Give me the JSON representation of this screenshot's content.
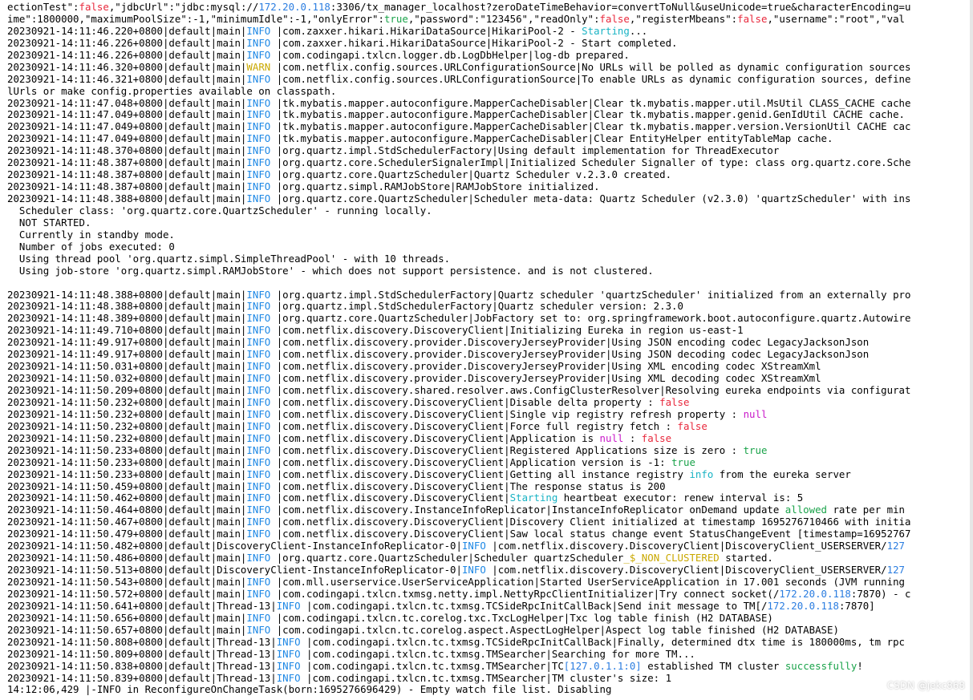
{
  "colors": {
    "false": "#e8283c",
    "null": "#c918c9",
    "true": "#1aa34a",
    "warn": "#c9a800",
    "info": "#1e88e5",
    "ip": "#2b7de0",
    "keyword": "#18b3c4"
  },
  "lines": [
    [
      [
        "ectionTest\":",
        ""
      ],
      [
        "false",
        "false"
      ],
      [
        ",\"jdbcUrl\":\"jdbc:mysql://",
        ""
      ],
      [
        "172.20.0.118",
        "ip"
      ],
      [
        ":3306/tx_manager_localhost?zeroDateTimeBehavior=convertToNull&useUnicode=true&characterEncoding=u",
        ""
      ]
    ],
    [
      [
        "ime\":1800000,\"maximumPoolSize\":-1,\"minimumIdle\":-1,\"onlyError\":",
        ""
      ],
      [
        "true",
        "true"
      ],
      [
        ",\"password\":\"123456\",\"readOnly\":",
        ""
      ],
      [
        "false",
        "false"
      ],
      [
        ",\"registerMbeans\":",
        ""
      ],
      [
        "false",
        "false"
      ],
      [
        ",\"username\":\"root\",\"val",
        ""
      ]
    ],
    [
      [
        "20230921-14:11:46.220+0800|default|main|",
        ""
      ],
      [
        "INFO",
        "info"
      ],
      [
        " |com.zaxxer.hikari.HikariDataSource|HikariPool-2 - ",
        ""
      ],
      [
        "Starting",
        "kw"
      ],
      [
        "...",
        ""
      ]
    ],
    [
      [
        "20230921-14:11:46.226+0800|default|main|",
        ""
      ],
      [
        "INFO",
        "info"
      ],
      [
        " |com.zaxxer.hikari.HikariDataSource|HikariPool-2 - Start completed.",
        ""
      ]
    ],
    [
      [
        "20230921-14:11:46.226+0800|default|main|",
        ""
      ],
      [
        "INFO",
        "info"
      ],
      [
        " |com.codingapi.txlcn.logger.db.LogDbHelper|log-db prepared.",
        ""
      ]
    ],
    [
      [
        "20230921-14:11:46.320+0800|default|main|",
        ""
      ],
      [
        "WARN",
        "warn"
      ],
      [
        " |com.netflix.config.sources.URLConfigurationSource|No URLs will be polled as dynamic configuration sources",
        ""
      ]
    ],
    [
      [
        "20230921-14:11:46.321+0800|default|main|",
        ""
      ],
      [
        "INFO",
        "info"
      ],
      [
        " |com.netflix.config.sources.URLConfigurationSource|To enable URLs as dynamic configuration sources, define",
        ""
      ]
    ],
    [
      [
        "lUrls or make config.properties available on classpath.",
        ""
      ]
    ],
    [
      [
        "20230921-14:11:47.048+0800|default|main|",
        ""
      ],
      [
        "INFO",
        "info"
      ],
      [
        " |tk.mybatis.mapper.autoconfigure.MapperCacheDisabler|Clear tk.mybatis.mapper.util.MsUtil CLASS_CACHE cache",
        ""
      ]
    ],
    [
      [
        "20230921-14:11:47.049+0800|default|main|",
        ""
      ],
      [
        "INFO",
        "info"
      ],
      [
        " |tk.mybatis.mapper.autoconfigure.MapperCacheDisabler|Clear tk.mybatis.mapper.genid.GenIdUtil CACHE cache.",
        ""
      ]
    ],
    [
      [
        "20230921-14:11:47.049+0800|default|main|",
        ""
      ],
      [
        "INFO",
        "info"
      ],
      [
        " |tk.mybatis.mapper.autoconfigure.MapperCacheDisabler|Clear tk.mybatis.mapper.version.VersionUtil CACHE cac",
        ""
      ]
    ],
    [
      [
        "20230921-14:11:47.049+0800|default|main|",
        ""
      ],
      [
        "INFO",
        "info"
      ],
      [
        " |tk.mybatis.mapper.autoconfigure.MapperCacheDisabler|Clear EntityHelper entityTableMap cache.",
        ""
      ]
    ],
    [
      [
        "20230921-14:11:48.370+0800|default|main|",
        ""
      ],
      [
        "INFO",
        "info"
      ],
      [
        " |org.quartz.impl.StdSchedulerFactory|Using default implementation for ThreadExecutor",
        ""
      ]
    ],
    [
      [
        "20230921-14:11:48.387+0800|default|main|",
        ""
      ],
      [
        "INFO",
        "info"
      ],
      [
        " |org.quartz.core.SchedulerSignalerImpl|Initialized Scheduler Signaller of type: class org.quartz.core.Sche",
        ""
      ]
    ],
    [
      [
        "20230921-14:11:48.387+0800|default|main|",
        ""
      ],
      [
        "INFO",
        "info"
      ],
      [
        " |org.quartz.core.QuartzScheduler|Quartz Scheduler v.2.3.0 created.",
        ""
      ]
    ],
    [
      [
        "20230921-14:11:48.387+0800|default|main|",
        ""
      ],
      [
        "INFO",
        "info"
      ],
      [
        " |org.quartz.simpl.RAMJobStore|RAMJobStore initialized.",
        ""
      ]
    ],
    [
      [
        "20230921-14:11:48.388+0800|default|main|",
        ""
      ],
      [
        "INFO",
        "info"
      ],
      [
        " |org.quartz.core.QuartzScheduler|Scheduler meta-data: Quartz Scheduler (v2.3.0) 'quartzScheduler' with ins",
        ""
      ]
    ],
    [
      [
        "  Scheduler class: 'org.quartz.core.QuartzScheduler' - running locally.",
        ""
      ]
    ],
    [
      [
        "  NOT STARTED.",
        ""
      ]
    ],
    [
      [
        "  Currently in standby mode.",
        ""
      ]
    ],
    [
      [
        "  Number of jobs executed: 0",
        ""
      ]
    ],
    [
      [
        "  Using thread pool 'org.quartz.simpl.SimpleThreadPool' - with 10 threads.",
        ""
      ]
    ],
    [
      [
        "  Using job-store 'org.quartz.simpl.RAMJobStore' - which does not support persistence. and is not clustered.",
        ""
      ]
    ],
    [],
    [
      [
        "20230921-14:11:48.388+0800|default|main|",
        ""
      ],
      [
        "INFO",
        "info"
      ],
      [
        " |org.quartz.impl.StdSchedulerFactory|Quartz scheduler 'quartzScheduler' initialized from an externally pro",
        ""
      ]
    ],
    [
      [
        "20230921-14:11:48.388+0800|default|main|",
        ""
      ],
      [
        "INFO",
        "info"
      ],
      [
        " |org.quartz.impl.StdSchedulerFactory|Quartz scheduler version: 2.3.0",
        ""
      ]
    ],
    [
      [
        "20230921-14:11:48.389+0800|default|main|",
        ""
      ],
      [
        "INFO",
        "info"
      ],
      [
        " |org.quartz.core.QuartzScheduler|JobFactory set to: org.springframework.boot.autoconfigure.quartz.Autowire",
        ""
      ]
    ],
    [
      [
        "20230921-14:11:49.710+0800|default|main|",
        ""
      ],
      [
        "INFO",
        "info"
      ],
      [
        " |com.netflix.discovery.DiscoveryClient|Initializing Eureka in region us-east-1",
        ""
      ]
    ],
    [
      [
        "20230921-14:11:49.917+0800|default|main|",
        ""
      ],
      [
        "INFO",
        "info"
      ],
      [
        " |com.netflix.discovery.provider.DiscoveryJerseyProvider|Using JSON encoding codec LegacyJacksonJson",
        ""
      ]
    ],
    [
      [
        "20230921-14:11:49.917+0800|default|main|",
        ""
      ],
      [
        "INFO",
        "info"
      ],
      [
        " |com.netflix.discovery.provider.DiscoveryJerseyProvider|Using JSON decoding codec LegacyJacksonJson",
        ""
      ]
    ],
    [
      [
        "20230921-14:11:50.031+0800|default|main|",
        ""
      ],
      [
        "INFO",
        "info"
      ],
      [
        " |com.netflix.discovery.provider.DiscoveryJerseyProvider|Using XML encoding codec XStreamXml",
        ""
      ]
    ],
    [
      [
        "20230921-14:11:50.032+0800|default|main|",
        ""
      ],
      [
        "INFO",
        "info"
      ],
      [
        " |com.netflix.discovery.provider.DiscoveryJerseyProvider|Using XML decoding codec XStreamXml",
        ""
      ]
    ],
    [
      [
        "20230921-14:11:50.209+0800|default|main|",
        ""
      ],
      [
        "INFO",
        "info"
      ],
      [
        " |com.netflix.discovery.shared.resolver.aws.ConfigClusterResolver|Resolving eureka endpoints via configurat",
        ""
      ]
    ],
    [
      [
        "20230921-14:11:50.232+0800|default|main|",
        ""
      ],
      [
        "INFO",
        "info"
      ],
      [
        " |com.netflix.discovery.DiscoveryClient|Disable delta property : ",
        ""
      ],
      [
        "false",
        "false"
      ]
    ],
    [
      [
        "20230921-14:11:50.232+0800|default|main|",
        ""
      ],
      [
        "INFO",
        "info"
      ],
      [
        " |com.netflix.discovery.DiscoveryClient|Single vip registry refresh property : ",
        ""
      ],
      [
        "null",
        "null"
      ]
    ],
    [
      [
        "20230921-14:11:50.232+0800|default|main|",
        ""
      ],
      [
        "INFO",
        "info"
      ],
      [
        " |com.netflix.discovery.DiscoveryClient|Force full registry fetch : ",
        ""
      ],
      [
        "false",
        "false"
      ]
    ],
    [
      [
        "20230921-14:11:50.232+0800|default|main|",
        ""
      ],
      [
        "INFO",
        "info"
      ],
      [
        " |com.netflix.discovery.DiscoveryClient|Application is ",
        ""
      ],
      [
        "null",
        "null"
      ],
      [
        " : ",
        ""
      ],
      [
        "false",
        "false"
      ]
    ],
    [
      [
        "20230921-14:11:50.233+0800|default|main|",
        ""
      ],
      [
        "INFO",
        "info"
      ],
      [
        " |com.netflix.discovery.DiscoveryClient|Registered Applications size is zero : ",
        ""
      ],
      [
        "true",
        "true"
      ]
    ],
    [
      [
        "20230921-14:11:50.233+0800|default|main|",
        ""
      ],
      [
        "INFO",
        "info"
      ],
      [
        " |com.netflix.discovery.DiscoveryClient|Application version is -1: ",
        ""
      ],
      [
        "true",
        "true"
      ]
    ],
    [
      [
        "20230921-14:11:50.233+0800|default|main|",
        ""
      ],
      [
        "INFO",
        "info"
      ],
      [
        " |com.netflix.discovery.DiscoveryClient|Getting all instance registry ",
        ""
      ],
      [
        "info",
        "kw"
      ],
      [
        " from the eureka server",
        ""
      ]
    ],
    [
      [
        "20230921-14:11:50.459+0800|default|main|",
        ""
      ],
      [
        "INFO",
        "info"
      ],
      [
        " |com.netflix.discovery.DiscoveryClient|The response status is 200",
        ""
      ]
    ],
    [
      [
        "20230921-14:11:50.462+0800|default|main|",
        ""
      ],
      [
        "INFO",
        "info"
      ],
      [
        " |com.netflix.discovery.DiscoveryClient|",
        ""
      ],
      [
        "Starting",
        "kw"
      ],
      [
        " heartbeat executor: renew interval is: 5",
        ""
      ]
    ],
    [
      [
        "20230921-14:11:50.464+0800|default|main|",
        ""
      ],
      [
        "INFO",
        "info"
      ],
      [
        " |com.netflix.discovery.InstanceInfoReplicator|InstanceInfoReplicator onDemand update ",
        ""
      ],
      [
        "allowed",
        "true"
      ],
      [
        " rate per min",
        ""
      ]
    ],
    [
      [
        "20230921-14:11:50.467+0800|default|main|",
        ""
      ],
      [
        "INFO",
        "info"
      ],
      [
        " |com.netflix.discovery.DiscoveryClient|Discovery Client initialized at timestamp 1695276710466 with initia",
        ""
      ]
    ],
    [
      [
        "20230921-14:11:50.479+0800|default|main|",
        ""
      ],
      [
        "INFO",
        "info"
      ],
      [
        " |com.netflix.discovery.DiscoveryClient|Saw local status change event StatusChangeEvent [timestamp=16952767",
        ""
      ]
    ],
    [
      [
        "20230921-14:11:50.482+0800|default|DiscoveryClient-InstanceInfoReplicator-0|",
        ""
      ],
      [
        "INFO",
        "info"
      ],
      [
        " |com.netflix.discovery.DiscoveryClient|DiscoveryClient_USERSERVER/",
        ""
      ],
      [
        "127",
        "ip"
      ]
    ],
    [
      [
        "20230921-14:11:50.486+0800|default|main|",
        ""
      ],
      [
        "INFO",
        "info"
      ],
      [
        " |org.quartz.core.QuartzScheduler|Scheduler quartzScheduler",
        ""
      ],
      [
        "_$_NON_CLUSTERED",
        "warn"
      ],
      [
        " started.",
        ""
      ]
    ],
    [
      [
        "20230921-14:11:50.513+0800|default|DiscoveryClient-InstanceInfoReplicator-0|",
        ""
      ],
      [
        "INFO",
        "info"
      ],
      [
        " |com.netflix.discovery.DiscoveryClient|DiscoveryClient_USERSERVER/",
        ""
      ],
      [
        "127",
        "ip"
      ]
    ],
    [
      [
        "20230921-14:11:50.543+0800|default|main|",
        ""
      ],
      [
        "INFO",
        "info"
      ],
      [
        " |com.mll.userservice.UserServiceApplication|Started UserServiceApplication in 17.001 seconds (JVM running",
        ""
      ]
    ],
    [
      [
        "20230921-14:11:50.572+0800|default|main|",
        ""
      ],
      [
        "INFO",
        "info"
      ],
      [
        " |com.codingapi.txlcn.txmsg.netty.impl.NettyRpcClientInitializer|Try connect socket(/",
        ""
      ],
      [
        "172.20.0.118",
        "ip"
      ],
      [
        ":7870) - c",
        ""
      ]
    ],
    [
      [
        "20230921-14:11:50.641+0800|default|Thread-13|",
        ""
      ],
      [
        "INFO",
        "info"
      ],
      [
        " |com.codingapi.txlcn.tc.txmsg.TCSideRpcInitCallBack|Send init message to TM[/",
        ""
      ],
      [
        "172.20.0.118",
        "ip"
      ],
      [
        ":7870]",
        ""
      ]
    ],
    [
      [
        "20230921-14:11:50.656+0800|default|main|",
        ""
      ],
      [
        "INFO",
        "info"
      ],
      [
        " |com.codingapi.txlcn.tc.corelog.txc.TxcLogHelper|Txc log table finish (H2 DATABASE)",
        ""
      ]
    ],
    [
      [
        "20230921-14:11:50.657+0800|default|main|",
        ""
      ],
      [
        "INFO",
        "info"
      ],
      [
        " |com.codingapi.txlcn.tc.corelog.aspect.AspectLogHelper|Aspect log table finished (H2 DATABASE)",
        ""
      ]
    ],
    [
      [
        "20230921-14:11:50.808+0800|default|Thread-13|",
        ""
      ],
      [
        "INFO",
        "info"
      ],
      [
        " |com.codingapi.txlcn.tc.txmsg.TCSideRpcInitCallBack|Finally, determined dtx time is 180000ms, tm rpc",
        ""
      ]
    ],
    [
      [
        "20230921-14:11:50.809+0800|default|Thread-13|",
        ""
      ],
      [
        "INFO",
        "info"
      ],
      [
        " |com.codingapi.txlcn.tc.txmsg.TMSearcher|Searching for more TM...",
        ""
      ]
    ],
    [
      [
        "20230921-14:11:50.838+0800|default|Thread-13|",
        ""
      ],
      [
        "INFO",
        "info"
      ],
      [
        " |com.codingapi.txlcn.tc.txmsg.TMSearcher|TC",
        ""
      ],
      [
        "[127.0.1.1:0]",
        "ip"
      ],
      [
        " established TM cluster ",
        ""
      ],
      [
        "successfully",
        "true"
      ],
      [
        "!",
        ""
      ]
    ],
    [
      [
        "20230921-14:11:50.839+0800|default|Thread-13|",
        ""
      ],
      [
        "INFO",
        "info"
      ],
      [
        " |com.codingapi.txlcn.tc.txmsg.TMSearcher|TM cluster's size: 1",
        ""
      ]
    ],
    [
      [
        "14:12:06,429 |-INFO in ReconfigureOnChangeTask(born:1695276696429) - Empty watch file list. Disabling",
        ""
      ]
    ]
  ],
  "watermark": "CSDN @jekc868"
}
